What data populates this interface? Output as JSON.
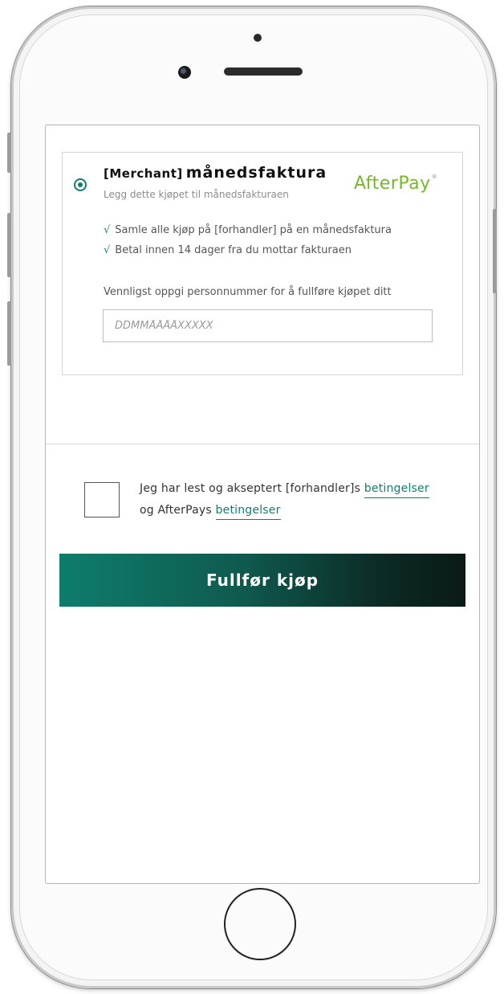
{
  "payment_option": {
    "merchant_tag": "[Merchant]",
    "title": "månedsfaktura",
    "subtitle": "Legg dette kjøpet til månedsfakturaen",
    "logo_text": "AfterPay",
    "logo_mark": "®",
    "benefits": [
      "Samle alle kjøp på [forhandler] på en månedsfaktura",
      "Betal innen 14 dager fra du mottar fakturaen"
    ],
    "check_glyph": "√",
    "personnummer_label": "Vennligst oppgi personnummer for å fullføre kjøpet ditt",
    "personnummer_placeholder": "DDMMÅÅÅÅXXXXX",
    "selected": true
  },
  "terms": {
    "line1_text": "Jeg har lest og akseptert [forhandler]s ",
    "line1_link": "betingelser",
    "line2_text": "og AfterPays ",
    "line2_link": "betingelser",
    "checked": false
  },
  "submit": {
    "label": "Fullfør kjøp"
  },
  "colors": {
    "accent": "#0f7f6c",
    "logo_green": "#76b82a",
    "button_gradient_start": "#0e7d6c",
    "button_gradient_end": "#0a1a16"
  }
}
